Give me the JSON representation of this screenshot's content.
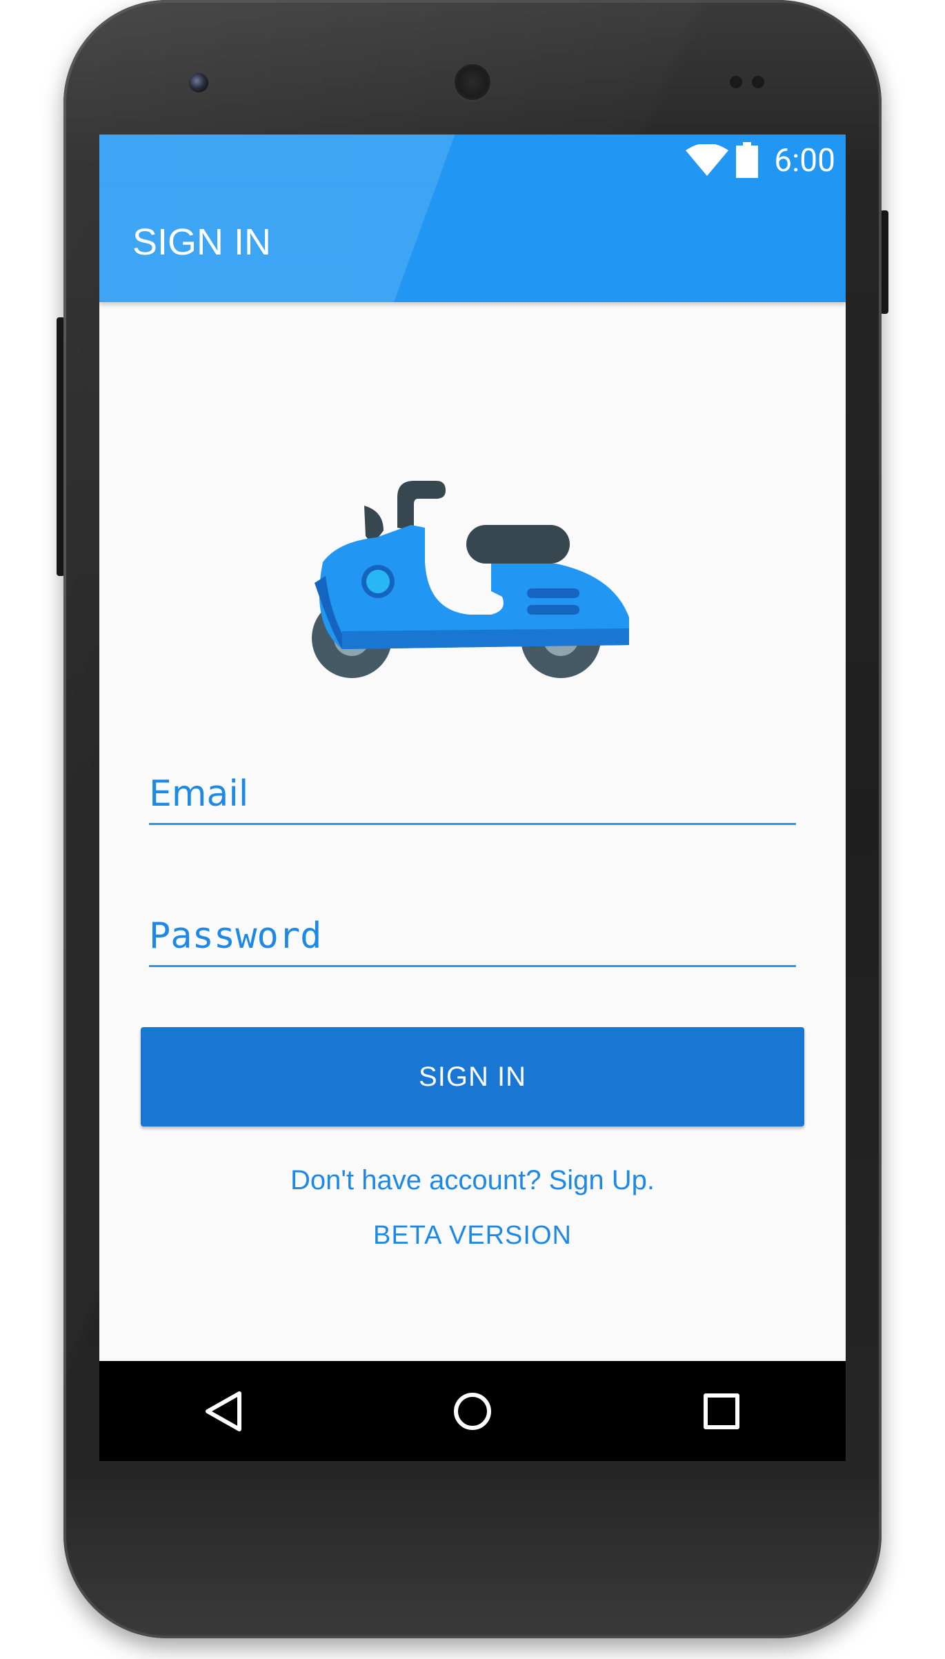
{
  "status_bar": {
    "time": "6:00",
    "icons": [
      "wifi-icon",
      "battery-icon"
    ]
  },
  "app_bar": {
    "title": "SIGN IN"
  },
  "logo": {
    "icon": "scooter-icon"
  },
  "form": {
    "email_placeholder": "Email",
    "email_value": "",
    "password_placeholder": "Password",
    "password_value": "",
    "signin_label": "SIGN IN",
    "signup_link": "Don't have account? Sign Up.",
    "version_label": "BETA VERSION"
  },
  "nav_bar": {
    "buttons": [
      "back-icon",
      "home-icon",
      "recents-icon"
    ]
  },
  "colors": {
    "primary": "#2196f3",
    "button": "#1976d2",
    "accent_text": "#1e88e5",
    "screen_background": "#fafafa"
  }
}
